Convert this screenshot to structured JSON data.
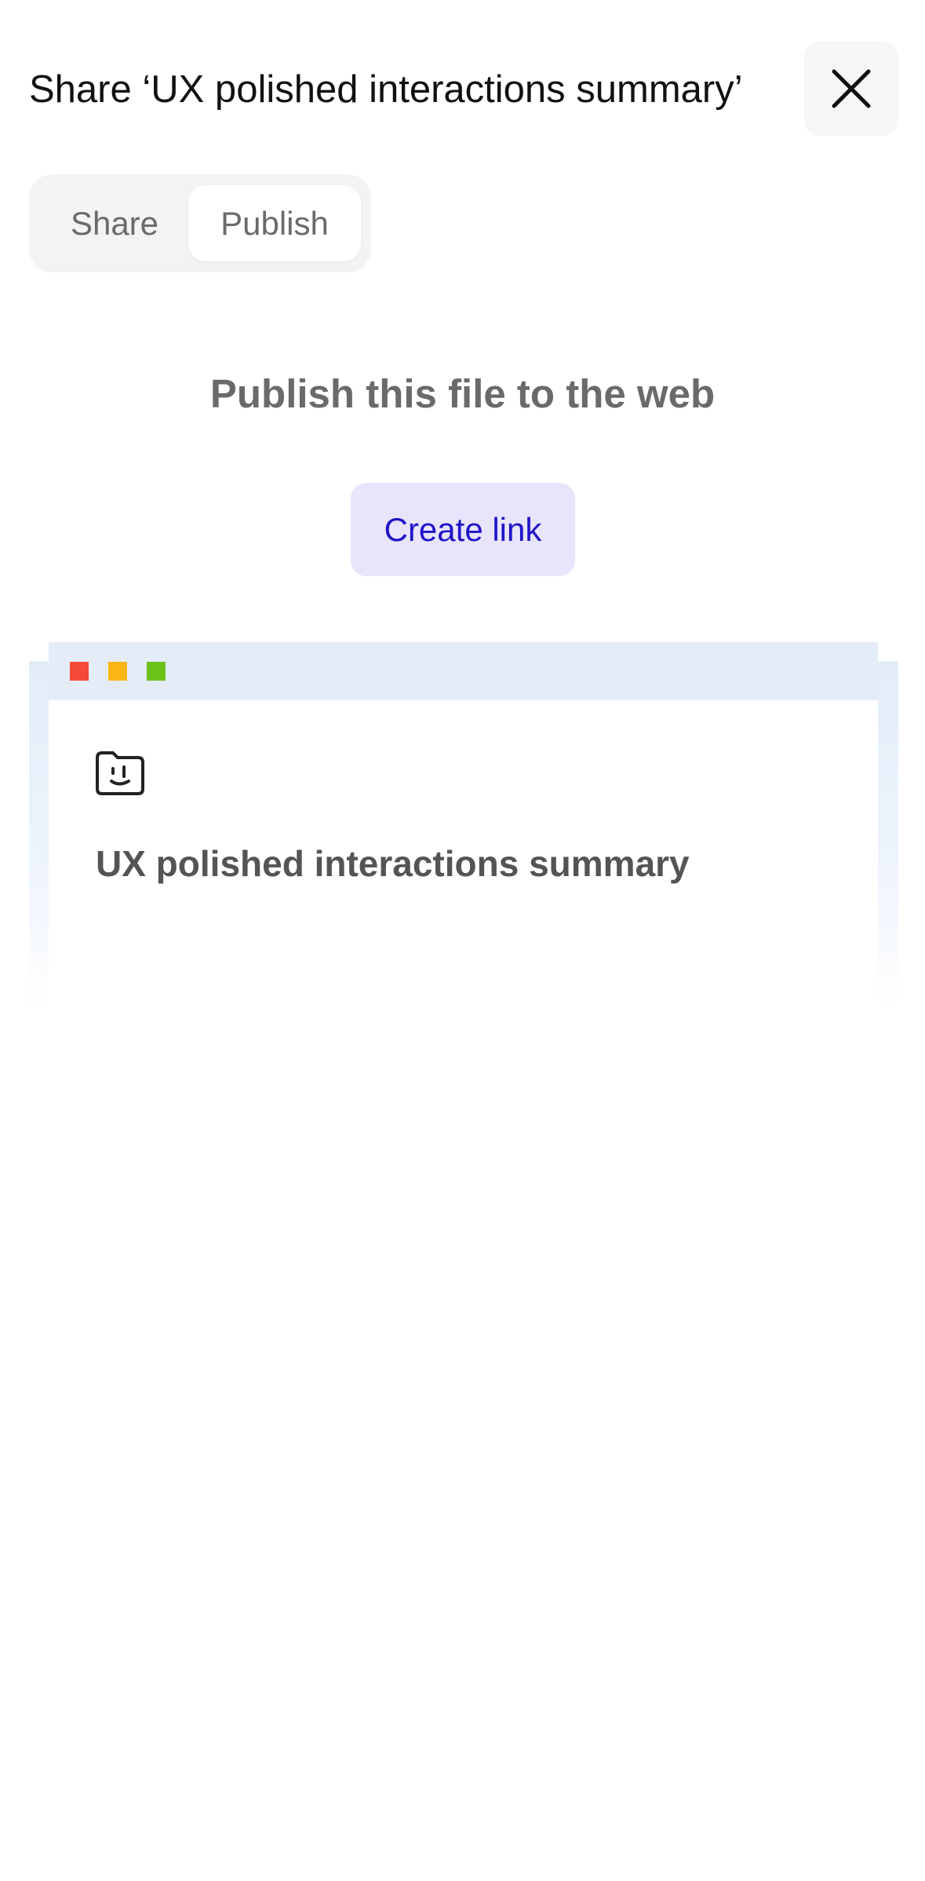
{
  "header": {
    "title": "Share ‘UX polished interactions summary’"
  },
  "tabs": {
    "share_label": "Share",
    "publish_label": "Publish",
    "selected": "Publish"
  },
  "publish": {
    "heading": "Publish this file to the web",
    "create_link_label": "Create link"
  },
  "preview": {
    "document_title": "UX polished interactions summary",
    "window_dot_colors": [
      "#f44a3a",
      "#fbb615",
      "#6cc11a"
    ]
  },
  "icons": {
    "close": "close-icon",
    "document": "folder-face-icon"
  },
  "colors": {
    "accent_text": "#1f13c8",
    "accent_bg": "#e8e4fb",
    "preview_bg": "#e4ecf8"
  }
}
